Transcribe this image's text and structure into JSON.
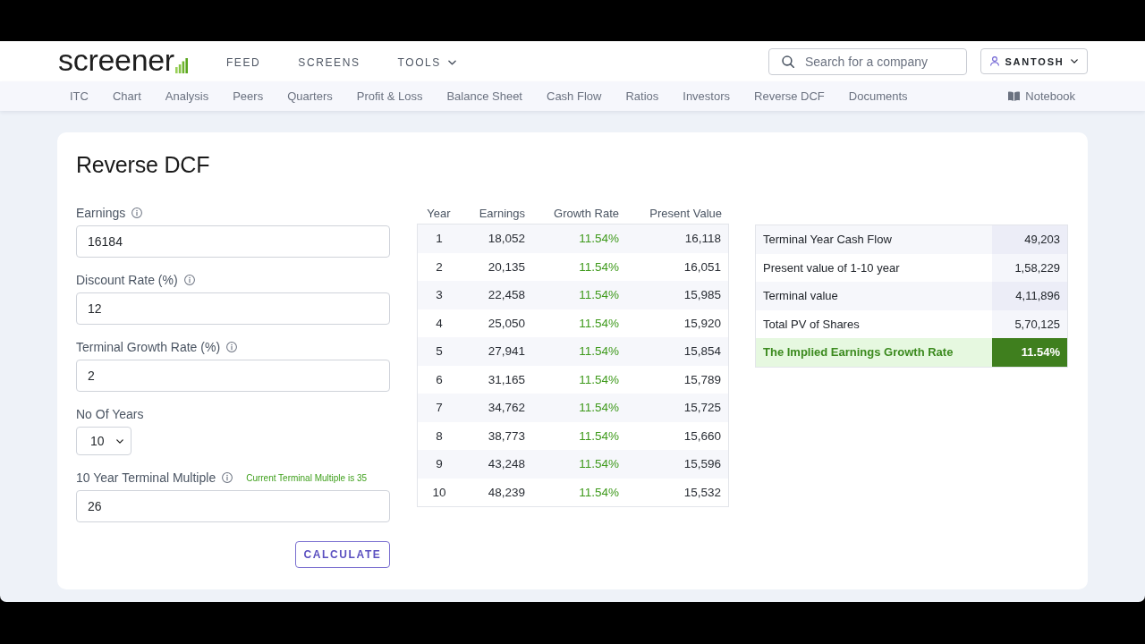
{
  "header": {
    "logo": "screener",
    "nav": [
      {
        "label": "FEED",
        "dropdown": false
      },
      {
        "label": "SCREENS",
        "dropdown": false
      },
      {
        "label": "TOOLS",
        "dropdown": true
      }
    ],
    "search": {
      "placeholder": "Search for a company"
    },
    "user": {
      "label": "SANTOSH"
    }
  },
  "subnav": {
    "items": [
      "ITC",
      "Chart",
      "Analysis",
      "Peers",
      "Quarters",
      "Profit & Loss",
      "Balance Sheet",
      "Cash Flow",
      "Ratios",
      "Investors",
      "Reverse DCF",
      "Documents"
    ],
    "notebook": "Notebook"
  },
  "card": {
    "title": "Reverse DCF",
    "fields": [
      {
        "kind": "input",
        "label": "Earnings",
        "info": true,
        "value": "16184"
      },
      {
        "kind": "input",
        "label": "Discount Rate (%)",
        "info": true,
        "value": "12"
      },
      {
        "kind": "input",
        "label": "Terminal Growth Rate (%)",
        "info": true,
        "value": "2"
      },
      {
        "kind": "select",
        "label": "No Of Years",
        "info": false,
        "value": "10"
      },
      {
        "kind": "input",
        "label": "10 Year Terminal Multiple",
        "info": true,
        "note": "Current Terminal Multiple is 35",
        "value": "26"
      }
    ],
    "button": "CALCULATE"
  },
  "projection_table": {
    "columns": [
      {
        "label": "Year",
        "kind": "index"
      },
      {
        "label": "Earnings",
        "kind": "number"
      },
      {
        "label": "Growth Rate",
        "kind": "rate"
      },
      {
        "label": "Present Value",
        "kind": "number"
      }
    ],
    "rows": [
      [
        "1",
        "18,052",
        "11.54%",
        "16,118"
      ],
      [
        "2",
        "20,135",
        "11.54%",
        "16,051"
      ],
      [
        "3",
        "22,458",
        "11.54%",
        "15,985"
      ],
      [
        "4",
        "25,050",
        "11.54%",
        "15,920"
      ],
      [
        "5",
        "27,941",
        "11.54%",
        "15,854"
      ],
      [
        "6",
        "31,165",
        "11.54%",
        "15,789"
      ],
      [
        "7",
        "34,762",
        "11.54%",
        "15,725"
      ],
      [
        "8",
        "38,773",
        "11.54%",
        "15,660"
      ],
      [
        "9",
        "43,248",
        "11.54%",
        "15,596"
      ],
      [
        "10",
        "48,239",
        "11.54%",
        "15,532"
      ]
    ]
  },
  "summary_table": {
    "rows": [
      {
        "label": "Terminal Year Cash Flow",
        "value": "49,203",
        "highlight": false
      },
      {
        "label": "Present value of 1-10 year",
        "value": "1,58,229",
        "highlight": false
      },
      {
        "label": "Terminal value",
        "value": "4,11,896",
        "highlight": false
      },
      {
        "label": "Total PV of Shares",
        "value": "5,70,125",
        "highlight": false
      },
      {
        "label": "The Implied Earnings Growth Rate",
        "value": "11.54%",
        "highlight": true
      }
    ]
  }
}
